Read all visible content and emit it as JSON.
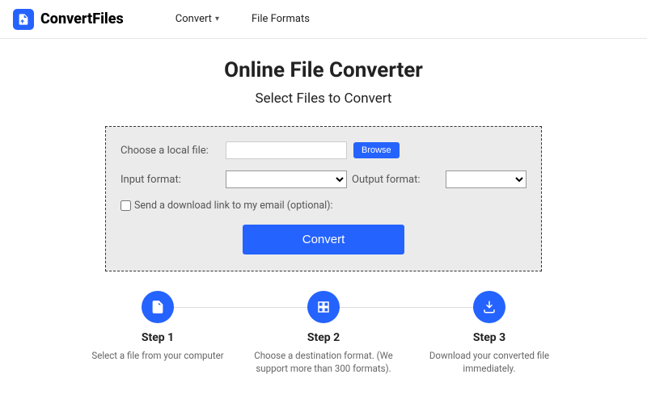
{
  "brand": "ConvertFiles",
  "nav": {
    "convert": "Convert",
    "fileformats": "File Formats"
  },
  "hero": {
    "title": "Online File Converter",
    "subtitle": "Select Files to Convert"
  },
  "panel": {
    "choose_label": "Choose a local file:",
    "browse": "Browse",
    "input_format_label": "Input format:",
    "output_format_label": "Output format:",
    "email_label": "Send a download link to my email (optional):",
    "convert": "Convert"
  },
  "steps": [
    {
      "title": "Step 1",
      "desc": "Select a file from your computer"
    },
    {
      "title": "Step 2",
      "desc": "Choose a destination format. (We support more than 300 formats)."
    },
    {
      "title": "Step 3",
      "desc": "Download your converted file immediately."
    }
  ]
}
